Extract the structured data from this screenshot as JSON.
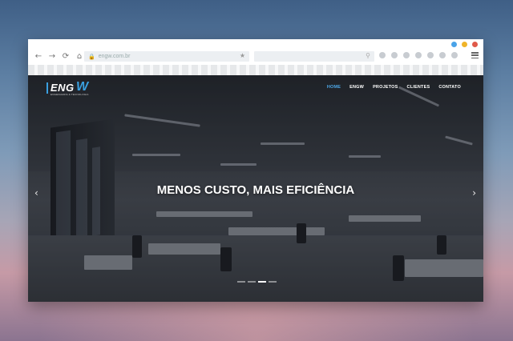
{
  "browser": {
    "window_controls": [
      "#4aa3e8",
      "#f0b429",
      "#e05a4a"
    ],
    "nav": {
      "back_icon": "←",
      "forward_icon": "→",
      "reload_icon": "⟳",
      "home_icon": "⌂"
    },
    "address_bar": {
      "value": "engw.com.br",
      "lock_icon": "🔒",
      "star_icon": "★"
    },
    "search_bar": {
      "value": "",
      "search_icon": "⚲"
    },
    "extensions": [
      "cloud-icon",
      "camera-icon",
      "info-icon",
      "sync-icon",
      "puzzle-icon",
      "shield-icon",
      "heart-icon"
    ]
  },
  "site": {
    "logo": {
      "text": "ENG",
      "accent": "W",
      "subtitle": "ENGENHARIA & TECNOLOGIA"
    },
    "nav": [
      {
        "label": "HOME",
        "active": true
      },
      {
        "label": "ENGW",
        "active": false
      },
      {
        "label": "PROJETOS",
        "active": false
      },
      {
        "label": "CLIENTES",
        "active": false
      },
      {
        "label": "CONTATO",
        "active": false
      }
    ],
    "hero": {
      "title": "MENOS CUSTO, MAIS EFICIÊNCIA",
      "prev_icon": "‹",
      "next_icon": "›",
      "slides": 4,
      "active_slide": 3
    },
    "colors": {
      "accent": "#4ea8e8"
    }
  }
}
